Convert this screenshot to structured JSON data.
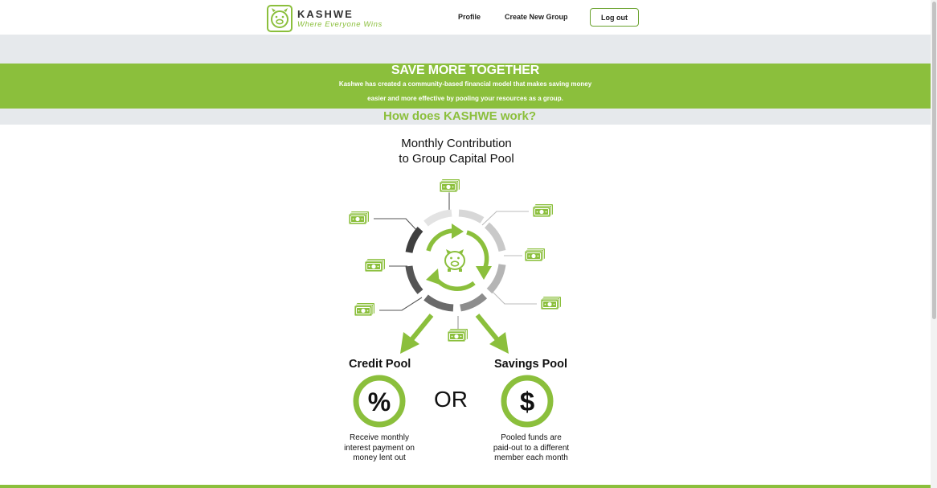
{
  "header": {
    "brand_name": "KASHWE",
    "tagline": "Where Everyone Wins",
    "nav": {
      "profile": "Profile",
      "create_group": "Create New Group",
      "logout": "Log out"
    }
  },
  "banner": {
    "title": "SAVE MORE TOGETHER",
    "line1": "Kashwe has created a community-based financial model that makes saving money",
    "line2": "easier and more effective by pooling your resources as a group."
  },
  "how_heading": "How does KASHWE work?",
  "diagram": {
    "title_line1": "Monthly Contribution",
    "title_line2": "to Group Capital Pool",
    "credit_pool": {
      "label": "Credit Pool",
      "symbol": "%",
      "desc_line1": "Receive monthly",
      "desc_line2": "interest payment on",
      "desc_line3": "money lent out"
    },
    "or_text": "OR",
    "savings_pool": {
      "label": "Savings Pool",
      "symbol": "$",
      "desc_line1": "Pooled funds are",
      "desc_line2": "paid-out to a different",
      "desc_line3": "member each month"
    }
  },
  "colors": {
    "accent": "#8bbf3c",
    "band": "#e6e9ec",
    "ring_dark": "#555555",
    "ring_light": "#dcdcdc"
  },
  "icons": {
    "logo": "pig-icon",
    "money": "money-icon",
    "center": "pig-icon"
  }
}
